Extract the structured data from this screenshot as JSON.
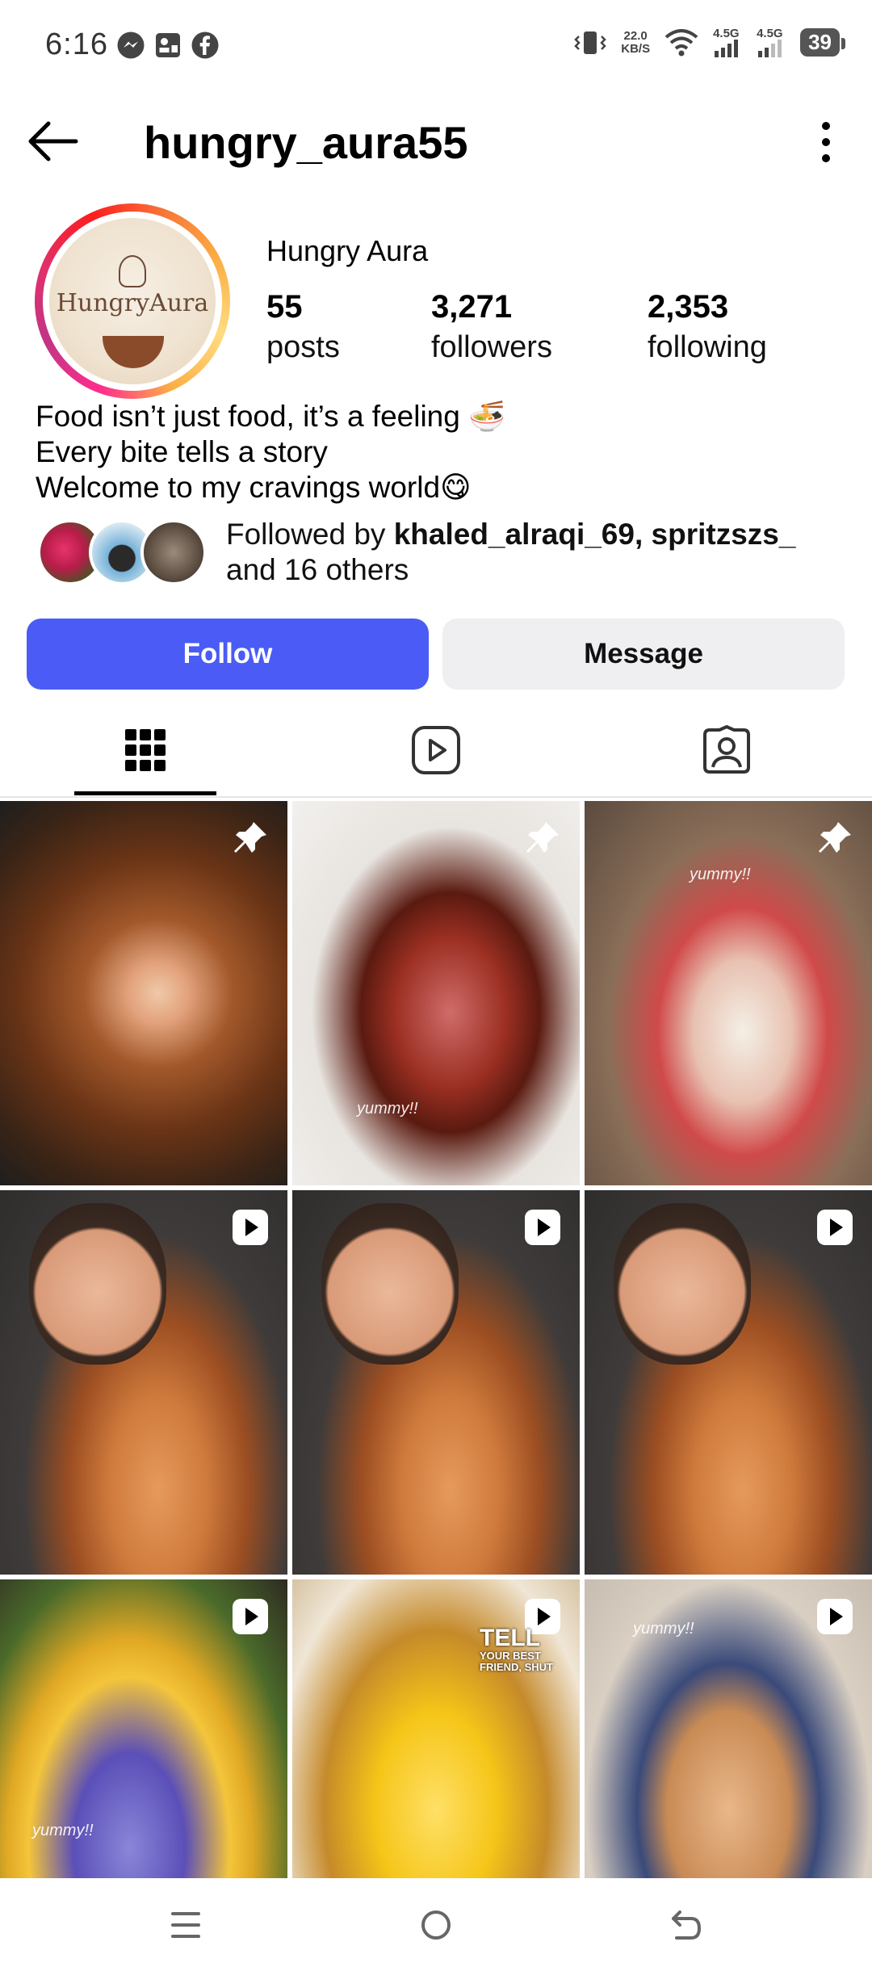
{
  "status_bar": {
    "time": "6:16",
    "net_speed_value": "22.0",
    "net_speed_unit": "KB/S",
    "signal1_label": "4.5G",
    "signal2_label": "4.5G",
    "battery": "39"
  },
  "header": {
    "username": "hungry_aura55"
  },
  "profile": {
    "avatar_logo_text": "HungryAura",
    "display_name": "Hungry Aura",
    "stats": {
      "posts_count": "55",
      "posts_label": "posts",
      "followers_count": "3,271",
      "followers_label": "followers",
      "following_count": "2,353",
      "following_label": "following"
    },
    "bio": [
      "Food isn’t just food, it’s a feeling 🍜",
      "Every bite tells a story",
      "Welcome to my cravings world😋"
    ],
    "followed_by": {
      "prefix": "Followed by",
      "names": "khaled_alraqi_69, spritzszs_",
      "suffix": "and 16 others"
    }
  },
  "actions": {
    "follow_label": "Follow",
    "message_label": "Message"
  },
  "tabs": [
    {
      "name": "posts-grid",
      "icon": "grid-icon",
      "active": true
    },
    {
      "name": "reels",
      "icon": "reels-icon",
      "active": false
    },
    {
      "name": "tagged",
      "icon": "tagged-icon",
      "active": false
    }
  ],
  "grid_posts": [
    {
      "type": "pinned",
      "overlay_text": ""
    },
    {
      "type": "pinned",
      "overlay_text": "yummy!!"
    },
    {
      "type": "pinned",
      "overlay_text": "yummy!!"
    },
    {
      "type": "reel",
      "overlay_text": ""
    },
    {
      "type": "reel",
      "overlay_text": ""
    },
    {
      "type": "reel",
      "overlay_text": ""
    },
    {
      "type": "reel",
      "overlay_text": "yummy!!"
    },
    {
      "type": "reel",
      "overlay_text": "TELL",
      "overlay_sub": "YOUR BEST FRIEND, SHUT"
    },
    {
      "type": "reel",
      "overlay_text": "yummy!!"
    }
  ],
  "colors": {
    "follow_button": "#4a5cf5",
    "message_button": "#efeff2",
    "story_ring": [
      "#c13584",
      "#fcaf45"
    ]
  }
}
